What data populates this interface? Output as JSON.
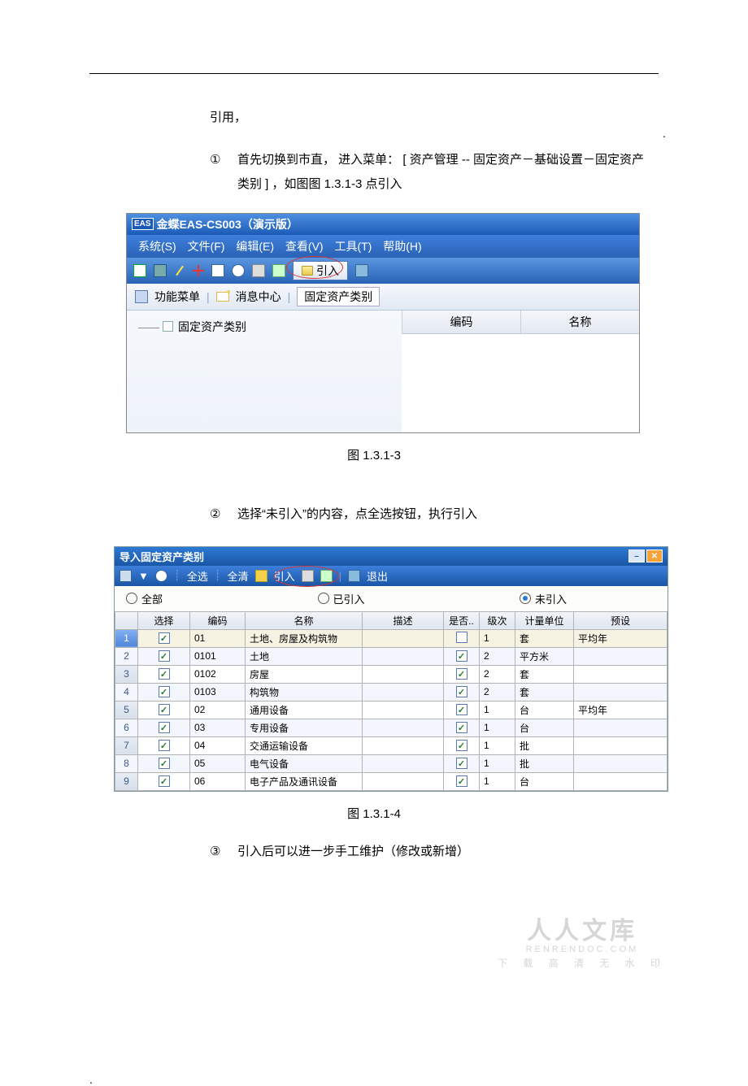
{
  "intro": "引用，",
  "step1_bullet": "①",
  "step1": "首先切换到市直， 进入菜单： [ 资产管理 -- 固定资产－基础设置－固定资产类别 ] ，如图图 1.3.1-3 点引入",
  "step2_bullet": "②",
  "step2": "选择“未引入”的内容，点全选按钮，执行引入",
  "step3_bullet": "③",
  "step3": "引入后可以进一步手工维护（修改或新增）",
  "fig1": {
    "title": "金蝶EAS-CS003（演示版）",
    "menus": [
      "系统(S)",
      "文件(F)",
      "编辑(E)",
      "查看(V)",
      "工具(T)",
      "帮助(H)"
    ],
    "import_btn": "引入",
    "sub_menu": "功能菜单",
    "sub_msg": "消息中心",
    "tab": "固定资产类别",
    "tree_node": "固定资产类别",
    "cols": [
      "编码",
      "名称"
    ],
    "caption": "图 1.3.1-3"
  },
  "fig2": {
    "title": "导入固定资产类别",
    "tb": {
      "all": "全选",
      "clear": "全清",
      "import": "引入",
      "exit": "退出"
    },
    "filter": {
      "all": "全部",
      "done": "已引入",
      "not": "未引入"
    },
    "cols": [
      "",
      "选择",
      "编码",
      "名称",
      "描述",
      "是否..",
      "级次",
      "计量单位",
      "预设"
    ],
    "rows": [
      {
        "n": "1",
        "sel": true,
        "code": "01",
        "name": "土地、房屋及构筑物",
        "desc": "",
        "flag": false,
        "lvl": "1",
        "unit": "套",
        "preset": "平均年"
      },
      {
        "n": "2",
        "sel": true,
        "code": "0101",
        "name": "土地",
        "desc": "",
        "flag": true,
        "lvl": "2",
        "unit": "平方米",
        "preset": ""
      },
      {
        "n": "3",
        "sel": true,
        "code": "0102",
        "name": "房屋",
        "desc": "",
        "flag": true,
        "lvl": "2",
        "unit": "套",
        "preset": ""
      },
      {
        "n": "4",
        "sel": true,
        "code": "0103",
        "name": "构筑物",
        "desc": "",
        "flag": true,
        "lvl": "2",
        "unit": "套",
        "preset": ""
      },
      {
        "n": "5",
        "sel": true,
        "code": "02",
        "name": "通用设备",
        "desc": "",
        "flag": true,
        "lvl": "1",
        "unit": "台",
        "preset": "平均年"
      },
      {
        "n": "6",
        "sel": true,
        "code": "03",
        "name": "专用设备",
        "desc": "",
        "flag": true,
        "lvl": "1",
        "unit": "台",
        "preset": ""
      },
      {
        "n": "7",
        "sel": true,
        "code": "04",
        "name": "交通运输设备",
        "desc": "",
        "flag": true,
        "lvl": "1",
        "unit": "批",
        "preset": ""
      },
      {
        "n": "8",
        "sel": true,
        "code": "05",
        "name": "电气设备",
        "desc": "",
        "flag": true,
        "lvl": "1",
        "unit": "批",
        "preset": ""
      },
      {
        "n": "9",
        "sel": true,
        "code": "06",
        "name": "电子产品及通讯设备",
        "desc": "",
        "flag": true,
        "lvl": "1",
        "unit": "台",
        "preset": ""
      }
    ],
    "caption": "图 1.3.1-4"
  },
  "watermark": {
    "big": "人人文库",
    "url": "RENRENDOC.COM",
    "sub": "下 载 高 清 无 水 印"
  }
}
